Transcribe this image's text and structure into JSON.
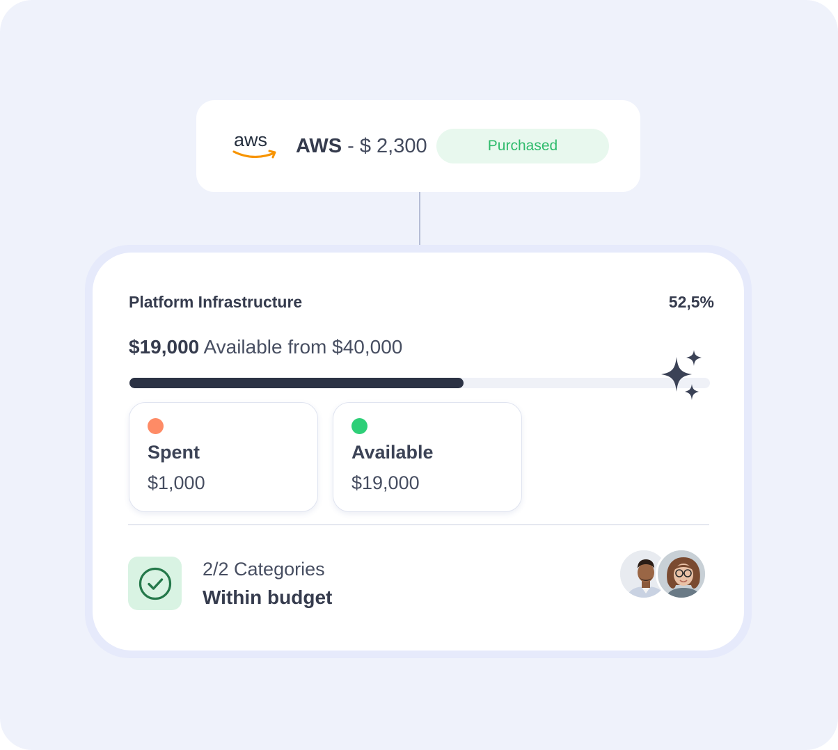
{
  "purchase": {
    "logo_text": "aws",
    "vendor": "AWS",
    "separator": "-",
    "amount": "$ 2,300",
    "status": "Purchased"
  },
  "budget": {
    "title": "Platform Infrastructure",
    "percent_label": "52,5%",
    "available_amount": "$19,000",
    "available_text": "Available from $40,000",
    "progress_fraction": 0.575
  },
  "stats": [
    {
      "label": "Spent",
      "value": "$1,000",
      "color": "#fe8b66"
    },
    {
      "label": "Available",
      "value": "$19,000",
      "color": "#2ecf78"
    }
  ],
  "categories": {
    "count_text": "2/2 Categories",
    "status_text": "Within budget"
  },
  "colors": {
    "accent_green": "#2fbb6c",
    "dark": "#2b3244",
    "background": "#eff2fb"
  }
}
